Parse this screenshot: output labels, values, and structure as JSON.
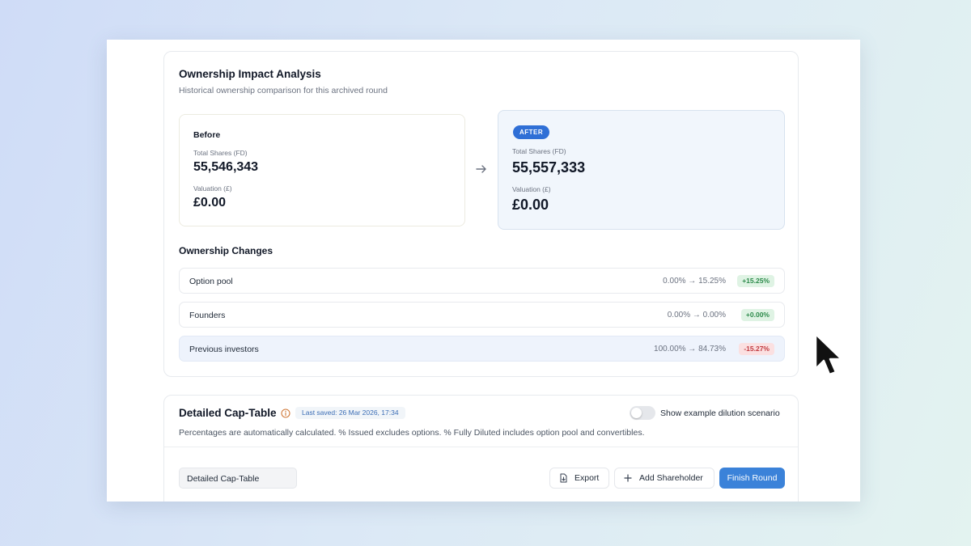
{
  "impact": {
    "title": "Ownership Impact Analysis",
    "subtitle": "Historical ownership comparison for this archived round",
    "before": {
      "heading": "Before",
      "shares_label": "Total Shares (FD)",
      "shares_value": "55,546,343",
      "valuation_label": "Valuation (£)",
      "valuation_value": "£0.00"
    },
    "after": {
      "badge": "AFTER",
      "shares_label": "Total Shares (FD)",
      "shares_value": "55,557,333",
      "valuation_label": "Valuation (£)",
      "valuation_value": "£0.00"
    },
    "changes_title": "Ownership Changes",
    "changes": [
      {
        "name": "Option pool",
        "change": "0.00% → 15.25%",
        "delta": "+15.25%",
        "direction": "positive"
      },
      {
        "name": "Founders",
        "change": "0.00% → 0.00%",
        "delta": "+0.00%",
        "direction": "positive"
      },
      {
        "name": "Previous investors",
        "change": "100.00% → 84.73%",
        "delta": "-15.27%",
        "direction": "negative"
      }
    ]
  },
  "captable": {
    "title": "Detailed Cap-Table",
    "last_saved": "Last saved: 26 Mar 2026, 17:34",
    "toggle_label": "Show example dilution scenario",
    "toggle_on": false,
    "description": "Percentages are automatically calculated. % Issued excludes options. % Fully Diluted includes option pool and convertibles.",
    "tab_label": "Detailed Cap-Table",
    "export_label": "Export",
    "add_label": "Add Shareholder",
    "finish_label": "Finish Round"
  },
  "colors": {
    "primary": "#3b82d9",
    "badge": "#2f6fd6",
    "positive_bg": "#dff3e4",
    "positive_text": "#2c8a4a",
    "negative_bg": "#fbe0e1",
    "negative_text": "#c0393f"
  },
  "icons": {
    "arrow": "arrow-right-icon",
    "info": "info-circle-icon",
    "export": "file-export-icon",
    "add": "plus-icon",
    "cursor": "mouse-pointer-icon"
  }
}
